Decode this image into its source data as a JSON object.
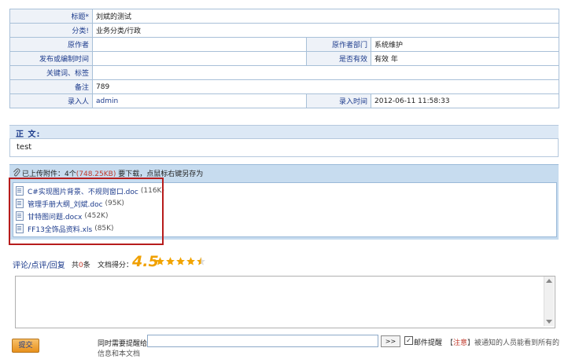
{
  "info": {
    "rows": [
      {
        "label": "标题*",
        "value": "刘斌的测试"
      },
      {
        "label": "分类!",
        "value": "业务分类/行政"
      },
      {
        "label": "原作者",
        "value": "",
        "label2": "原作者部门",
        "value2": "系统维护"
      },
      {
        "label": "发布或编制时间",
        "value": "",
        "label2": "是否有效",
        "value2": "有效  年"
      },
      {
        "label": "关键词、标签",
        "value": ""
      },
      {
        "label": "备注",
        "value": "789"
      },
      {
        "label": "录入人",
        "value": "admin",
        "label2": "录入时间",
        "value2": "2012-06-11 11:58:33"
      }
    ]
  },
  "body": {
    "header": "正   文:",
    "content": "test"
  },
  "attachments": {
    "prefix": "已上传附件：4个",
    "total_size": "(748.25KB)",
    "suffix": "要下载，点鼠标右键另存为",
    "items": [
      {
        "name": "C#实现图片背景、不规则窗口.doc",
        "size": "(116K)"
      },
      {
        "name": "管理手册大纲_刘斌.doc",
        "size": "(95K)"
      },
      {
        "name": "甘特图问题.docx",
        "size": "(452K)"
      },
      {
        "name": "FF13全饰品资料.xls",
        "size": "(85K)"
      }
    ]
  },
  "comments": {
    "label": "评论/点评/回复",
    "count_prefix": "共",
    "count": "0",
    "count_suffix": "条",
    "score_label": "文档得分：",
    "score": "4.5",
    "stars_filled": 4,
    "stars_half": 1
  },
  "footer": {
    "submit_label": "提交",
    "notify_label": "同时需要提醒给",
    "arrow_label": ">>",
    "checkbox_mark": "✓",
    "mail_label": "邮件提醒",
    "note_open": "【",
    "note_red": "注意",
    "note_text": "】被通知的人员能看到所有的",
    "info_line": "信息和本文档"
  },
  "colors": {
    "accent": "#1c3b8c",
    "header_bg": "#c7dcef",
    "highlight": "#b71c1c",
    "score": "#f0a000"
  }
}
